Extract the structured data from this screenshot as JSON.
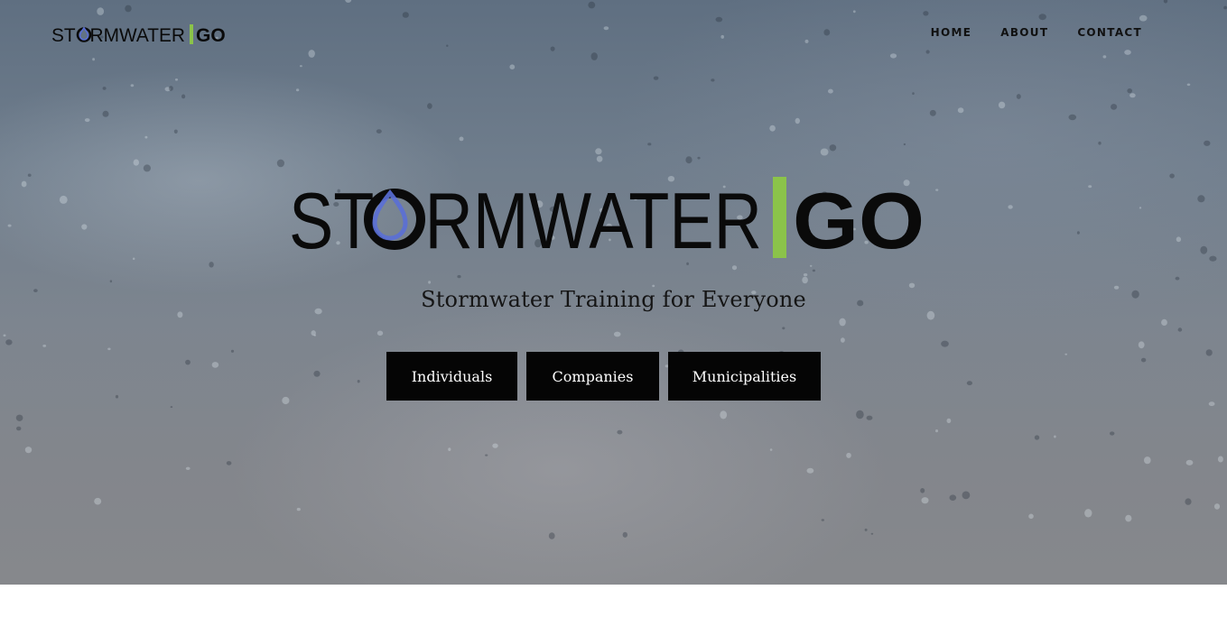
{
  "brand": {
    "word": "STORMWATER",
    "word_pre": "ST",
    "word_post": "RMWATER",
    "suffix": "GO",
    "logo_text": "STORMWATER | GO"
  },
  "nav": {
    "items": [
      "HOME",
      "ABOUT",
      "CONTACT"
    ]
  },
  "hero": {
    "tagline": "Stormwater Training for Everyone",
    "buttons": [
      "Individuals",
      "Companies",
      "Municipalities"
    ]
  },
  "colors": {
    "accent_green": "#8bc34a",
    "drop_blue": "#5a6fd6",
    "button_bg": "#050505",
    "logo_black": "#0a0a0a"
  },
  "icons": {
    "logo_o": "water-drop-icon"
  }
}
